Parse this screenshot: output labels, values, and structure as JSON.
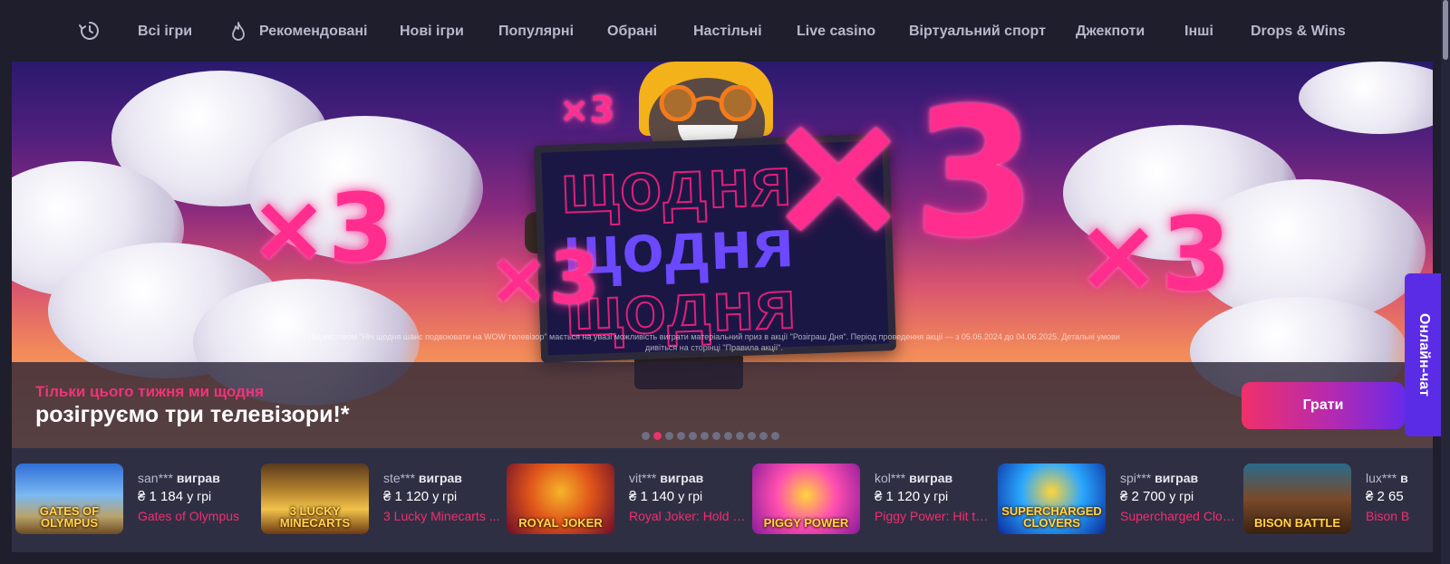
{
  "nav": {
    "items": [
      "Всі ігри",
      "Рекомендовані",
      "Нові ігри",
      "Популярні",
      "Обрані",
      "Настільні",
      "Live casino",
      "Віртуальний спорт",
      "Джекпоти",
      "Інші",
      "Drops & Wins"
    ]
  },
  "banner": {
    "tv_word": "щодня",
    "multiplier": "×3",
    "disclaimer": "Під вислівом \"Ніч щодня шанс подвоювати на WOW телевізор\" мається на увазі можливість виграти матеріальний приз в акції \"Розіграш Дня\". Період проведення акції — з 05.06.2024 до 04.06.2025. Детальні умови дивіться на сторінці \"Правила акції\".",
    "subtitle": "Тільки цього тижня ми щодня",
    "title": "розігруємо три телевізори!*",
    "play_label": "Грати",
    "slides": 12,
    "active_slide": 2
  },
  "chat": {
    "label": "Онлайн-чат"
  },
  "winners": [
    {
      "user": "san***",
      "verb": "виграв",
      "amount": "₴ 1 184",
      "unit": "у грі",
      "game": "Gates of Olympus",
      "logo": "GATES OF OLYMPUS"
    },
    {
      "user": "ste***",
      "verb": "виграв",
      "amount": "₴ 1 120",
      "unit": "у грі",
      "game": "3 Lucky Minecarts ...",
      "logo": "3 LUCKY MINECARTS"
    },
    {
      "user": "vit***",
      "verb": "виграв",
      "amount": "₴ 1 140",
      "unit": "у грі",
      "game": "Royal Joker: Hold a...",
      "logo": "ROYAL JOKER"
    },
    {
      "user": "kol***",
      "verb": "виграв",
      "amount": "₴ 1 120",
      "unit": "у грі",
      "game": "Piggy Power: Hit th...",
      "logo": "PIGGY POWER"
    },
    {
      "user": "spi***",
      "verb": "виграв",
      "amount": "₴ 2 700",
      "unit": "у грі",
      "game": "Supercharged Clov...",
      "logo": "SUPERCHARGED CLOVERS"
    },
    {
      "user": "lux***",
      "verb": "в",
      "amount": "₴ 2 65",
      "unit": "",
      "game": "Bison B",
      "logo": "BISON BATTLE"
    }
  ],
  "colors": {
    "accent": "#e8336d",
    "chat": "#5b2ce6",
    "nav_text": "#b7b9cb"
  }
}
